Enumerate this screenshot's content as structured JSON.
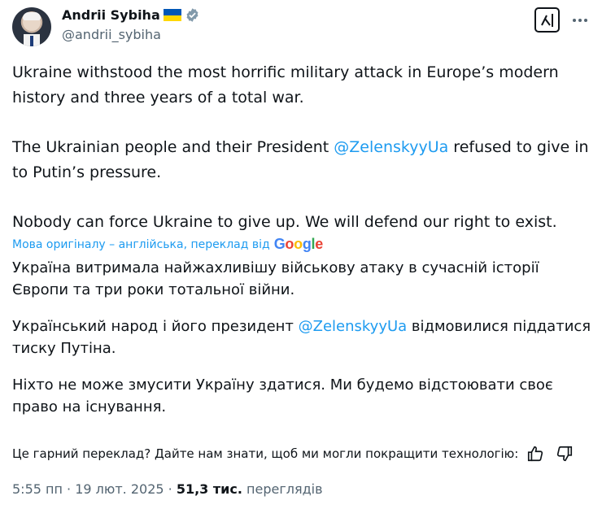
{
  "author": {
    "name": "Andrii Sybiha",
    "handle": "@andrii_sybiha"
  },
  "post": {
    "p1": "Ukraine withstood the most horrific military attack in Europe’s modern history and three years of a total war.",
    "p2_before": "The Ukrainian people and their President ",
    "p2_mention": "@ZelenskyyUa",
    "p2_after": " refused to give in to Putin’s pressure.",
    "p3": "Nobody can force Ukraine to give up. We will defend our right to exist."
  },
  "translation": {
    "note": "Мова оригіналу – англійська, переклад від",
    "provider": "Google",
    "p1": "Україна витримала найжахливішу військову атаку в сучасній історії Європи та три роки тотальної війни.",
    "p2_before": "Український народ і його президент ",
    "p2_mention": "@ZelenskyyUa",
    "p2_after": " відмовилися піддатися тиску Путіна.",
    "p3": "Ніхто не може змусити Україну здатися. Ми будемо відстоювати своє право на існування."
  },
  "feedback": {
    "text": "Це гарний переклад? Дайте нам знати, щоб ми могли покращити технологію:"
  },
  "meta": {
    "time": "5:55 пп",
    "sep1": " · ",
    "date": "19 лют. 2025",
    "sep2": " · ",
    "views_count": "51,3 тис.",
    "views_label": " переглядів"
  },
  "icons": {
    "verified": "verified-badge-icon",
    "flag": "ukraine-flag-icon",
    "grok": "grok-icon",
    "more": "more-icon",
    "thumbs_up": "thumbs-up-icon",
    "thumbs_down": "thumbs-down-icon"
  },
  "colors": {
    "accent": "#1d9bf0",
    "text": "#0f1419",
    "secondary": "#536471",
    "flag_blue": "#0057b7",
    "flag_yellow": "#ffd700"
  }
}
